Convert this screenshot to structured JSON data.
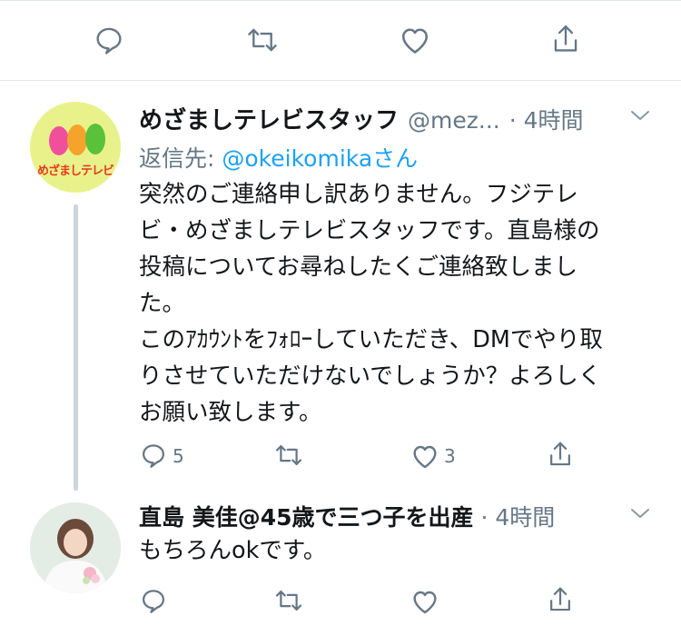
{
  "top_actions": {
    "reply_icon": "reply-icon",
    "retweet_icon": "retweet-icon",
    "like_icon": "heart-icon",
    "share_icon": "share-icon"
  },
  "tweet1": {
    "display_name": "めざましテレビスタッフ",
    "handle": "@mez...",
    "time": "· 4時間",
    "reply_to_prefix": "返信先:",
    "reply_to_handle": "@okeikomika",
    "reply_to_suffix": "さん",
    "avatar_text": "めざましテレビ",
    "avatar_colors": {
      "bg": "#e9f28a",
      "egg_pink": "#f0509b",
      "egg_orange": "#f6a32c",
      "egg_green": "#59c23a",
      "text": "#e8371f"
    },
    "body_lines": [
      "突然のご連絡申し訳ありません。フジテレ",
      "ビ・めざましテレビスタッフです。直島様の",
      "投稿についてお尋ねしたくご連絡致しまし",
      "た。",
      "このｱｶｳﾝﾄをﾌｫﾛｰしていただき、DMでやり取",
      "りさせていただけないでしょうか？よろしく",
      "お願い致します。"
    ],
    "reply_count": "5",
    "like_count": "3"
  },
  "tweet2": {
    "display_name": "直島 美佳@45歳で三つ子を出産",
    "time": "· 4時間",
    "body": "もちろんokです。"
  },
  "colors": {
    "link": "#1da1f2",
    "secondary": "#657786",
    "divider": "#e1e8ed",
    "thread": "#ccd6dd"
  }
}
